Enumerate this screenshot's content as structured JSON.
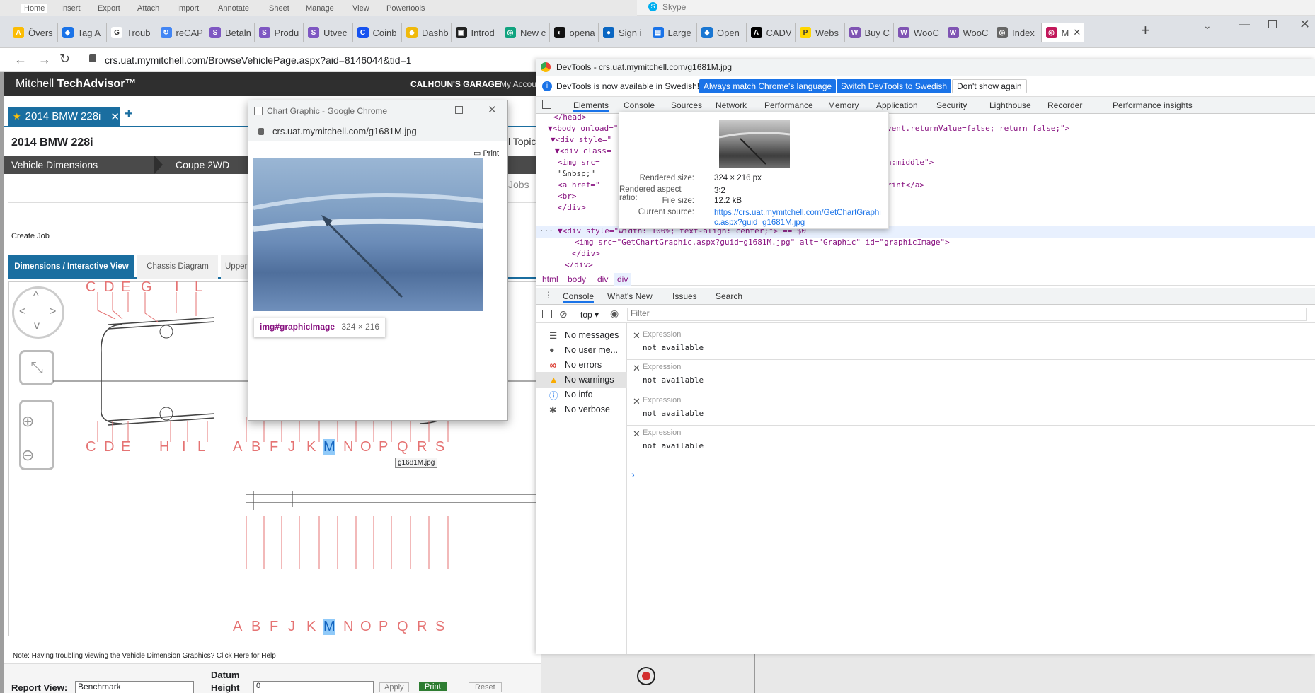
{
  "top_menu": [
    "Home",
    "Insert",
    "Export",
    "Attach",
    "Import",
    "Annotate",
    "Sheet",
    "Manage",
    "View",
    "Powertools"
  ],
  "skype_title": "Skype",
  "browser_tabs": [
    {
      "label": "Övers",
      "color": "#fbbc04",
      "glyph": "A"
    },
    {
      "label": "Tag A",
      "color": "#1a73e8",
      "glyph": "◆"
    },
    {
      "label": "Troub",
      "color": "#ffffff",
      "glyph": "G"
    },
    {
      "label": "reCAP",
      "color": "#4285f4",
      "glyph": "↻"
    },
    {
      "label": "Betaln",
      "color": "#7e57c2",
      "glyph": "S"
    },
    {
      "label": "Produ",
      "color": "#7e57c2",
      "glyph": "S"
    },
    {
      "label": "Utvec",
      "color": "#7e57c2",
      "glyph": "S"
    },
    {
      "label": "Coinb",
      "color": "#1652f0",
      "glyph": "C"
    },
    {
      "label": "Dashb",
      "color": "#f0b90b",
      "glyph": "◆"
    },
    {
      "label": "Introd",
      "color": "#222222",
      "glyph": "▣"
    },
    {
      "label": "New c",
      "color": "#10a37f",
      "glyph": "◎"
    },
    {
      "label": "opena",
      "color": "#111111",
      "glyph": "◐"
    },
    {
      "label": "Sign i",
      "color": "#0a66c2",
      "glyph": "●"
    },
    {
      "label": "Large",
      "color": "#1a73e8",
      "glyph": "▤"
    },
    {
      "label": "Open",
      "color": "#1976d2",
      "glyph": "◆"
    },
    {
      "label": "CADV",
      "color": "#000000",
      "glyph": "A"
    },
    {
      "label": "Webs",
      "color": "#ffd600",
      "glyph": "P"
    },
    {
      "label": "Buy C",
      "color": "#7f54b3",
      "glyph": "W"
    },
    {
      "label": "WooC",
      "color": "#7f54b3",
      "glyph": "W"
    },
    {
      "label": "WooC",
      "color": "#7f54b3",
      "glyph": "W"
    },
    {
      "label": "Index",
      "color": "#666666",
      "glyph": "◎"
    },
    {
      "label": "M",
      "color": "#c2185b",
      "glyph": "◎"
    }
  ],
  "address": "crs.uat.mymitchell.com/BrowseVehiclePage.aspx?aid=8146044&tid=1",
  "mitchell": {
    "brand_light": "Mitchell ",
    "brand_bold": "TechAdvisor™",
    "garage": "CALHOUN'S GARAGE",
    "account": "My Accou",
    "vehicle_tab": "2014 BMW 228i",
    "add_tab": "+",
    "vehicle_title": "2014 BMW 228i",
    "vd_label": "Vehicle Dimensions",
    "vd_value": "Coupe 2WD",
    "topic_partial": "l Topic",
    "jobs_partial": "Jobs",
    "create_job": "Create Job",
    "sub_tabs": [
      "Dimensions / Interactive View",
      "Chassis Diagram",
      "Upper"
    ],
    "tooltip_file": "g1681M.jpg",
    "top_letters": [
      "C",
      "D",
      "E",
      "G",
      "I",
      "L"
    ],
    "bottom_letters_left": [
      "C",
      "D",
      "E",
      "H",
      "I",
      "L"
    ],
    "bottom_letters_right": [
      "A",
      "B",
      "F",
      "J",
      "K",
      "M",
      "N",
      "O",
      "P",
      "Q",
      "R",
      "S"
    ],
    "note": "Note: Having troubling viewing the Vehicle Dimension Graphics? Click Here for Help",
    "report_view_label": "Report View:",
    "report_view_value": "Benchmark",
    "datum_label": "Datum",
    "height_label": "Height",
    "height_value": "0",
    "apply": "Apply",
    "print": "Print",
    "reset": "Reset"
  },
  "popup": {
    "title": "Chart Graphic - Google Chrome",
    "url": "crs.uat.mymitchell.com/g1681M.jpg",
    "print": "Print",
    "inspect_tag": "img#graphicImage",
    "inspect_size": "324 × 216"
  },
  "devtools": {
    "title": "DevTools - crs.uat.mymitchell.com/g1681M.jpg",
    "banner": "DevTools is now available in Swedish!",
    "btn_match": "Always match Chrome's language",
    "btn_switch": "Switch DevTools to Swedish",
    "btn_dont": "Don't show again",
    "tabs": [
      "Elements",
      "Console",
      "Sources",
      "Network",
      "Performance",
      "Memory",
      "Application",
      "Security",
      "Lighthouse",
      "Recorder",
      "Performance insights"
    ],
    "code_lines": [
      "</head>",
      "▼<body onload=\"",
      "  ▼<div style=\"",
      "    ▼<div class=",
      "       <img src=",
      "       \"&nbsp;\"",
      "       <a href=\"",
      "       <br>",
      "     </div>",
      "    ▼<div style=\"width: 100%; text-align: center;\"> == $0",
      "       <img src=\"GetChartGraphic.aspx?guid=g1681M.jpg\" alt=\"Graphic\" id=\"graphicImage\">",
      "     </div>",
      "   </div>"
    ],
    "code_right_1": "vent.returnValue=false; return false;\">",
    "code_right_2": "n:middle\">",
    "code_right_3": "rint</a>",
    "breadcrumbs": [
      "html",
      "body",
      "div",
      "div"
    ],
    "drawer_tabs": [
      "Console",
      "What's New",
      "Issues",
      "Search"
    ],
    "context": "top",
    "filter_placeholder": "Filter",
    "sidebar": [
      "No messages",
      "No user me...",
      "No errors",
      "No warnings",
      "No info",
      "No verbose"
    ],
    "expressions": [
      {
        "label": "Expression",
        "value": "not available"
      },
      {
        "label": "Expression",
        "value": "not available"
      },
      {
        "label": "Expression",
        "value": "not available"
      },
      {
        "label": "Expression",
        "value": "not available"
      }
    ],
    "prompt": "›"
  },
  "hover_card": {
    "rendered_size_label": "Rendered size:",
    "rendered_size": "324 × 216 px",
    "aspect_label": "Rendered aspect ratio:",
    "aspect": "3∶2",
    "file_size_label": "File size:",
    "file_size": "12.2 kB",
    "source_label": "Current source:",
    "source": "https://crs.uat.mymitchell.com/GetChartGraphic.aspx?guid=g1681M.jpg"
  }
}
